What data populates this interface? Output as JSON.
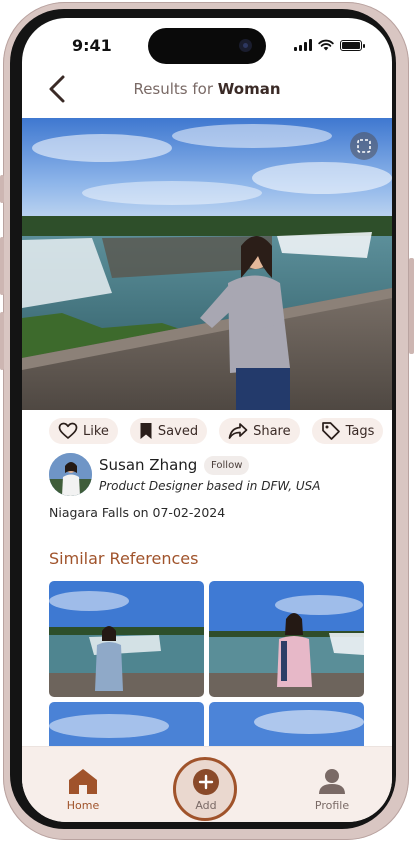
{
  "status": {
    "time": "9:41"
  },
  "header": {
    "prefix": "Results for",
    "query": "Woman"
  },
  "actions": {
    "like": "Like",
    "saved": "Saved",
    "share": "Share",
    "tags": "Tags"
  },
  "author": {
    "name": "Susan Zhang",
    "follow": "Follow",
    "bio": "Product Designer based in DFW, USA"
  },
  "location": "Niagara Falls on 07-02-2024",
  "similar": {
    "title": "Similar References"
  },
  "nav": {
    "home": "Home",
    "add": "Add",
    "profile": "Profile"
  },
  "colors": {
    "accent": "#a0532b",
    "chip_bg": "#f7eeea",
    "nav_bg": "#f7eeea",
    "frame": "#d9c6c2"
  }
}
